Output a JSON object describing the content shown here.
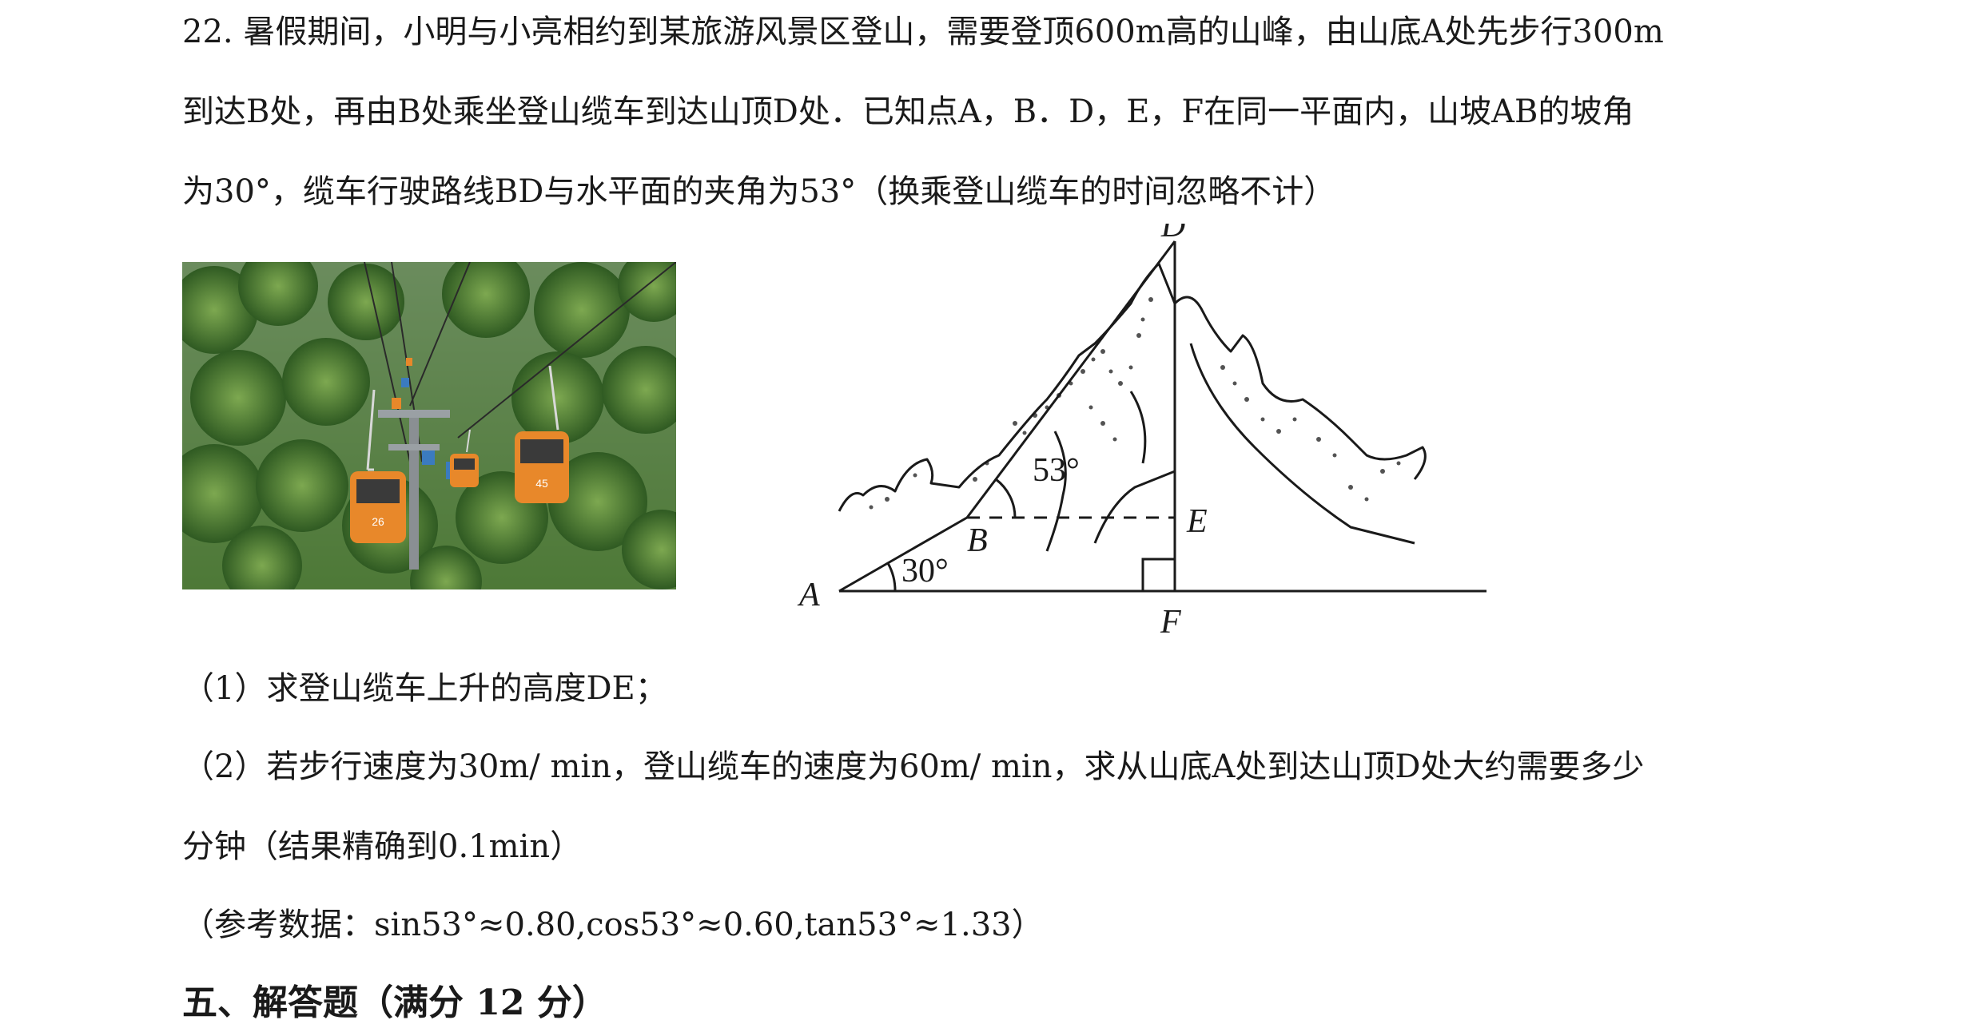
{
  "problem": {
    "line1": "22. 暑假期间，小明与小亮相约到某旅游风景区登山，需要登顶600m高的山峰，由山底A处先步行300m",
    "line2": "到达B处，再由B处乘坐登山缆车到达山顶D处．已知点A，B．D，E，F在同一平面内，山坡AB的坡角",
    "line3": "为30°，缆车行驶路线BD与水平面的夹角为53°（换乘登山缆车的时间忽略不计）"
  },
  "photo": {
    "cabin_numbers": [
      "26",
      "45"
    ]
  },
  "diagram": {
    "points": {
      "A": "A",
      "B": "B",
      "D": "D",
      "E": "E",
      "F": "F"
    },
    "angles": {
      "slope": "30°",
      "cable": "53°"
    }
  },
  "questions": {
    "q1": "（1）求登山缆车上升的高度DE；",
    "q2a": "（2）若步行速度为30m/ min，登山缆车的速度为60m/ min，求从山底A处到达山顶D处大约需要多少",
    "q2b": "分钟（结果精确到0.1min）",
    "reference": "（参考数据：sin53°≈0.80,cos53°≈0.60,tan53°≈1.33）"
  },
  "section": {
    "heading": "五、解答题（满分 12 分）"
  },
  "colors": {
    "text": "#1a1a1a",
    "foliage_dark": "#2f5a22",
    "foliage_light": "#7da850",
    "cabin": "#e8882a"
  }
}
